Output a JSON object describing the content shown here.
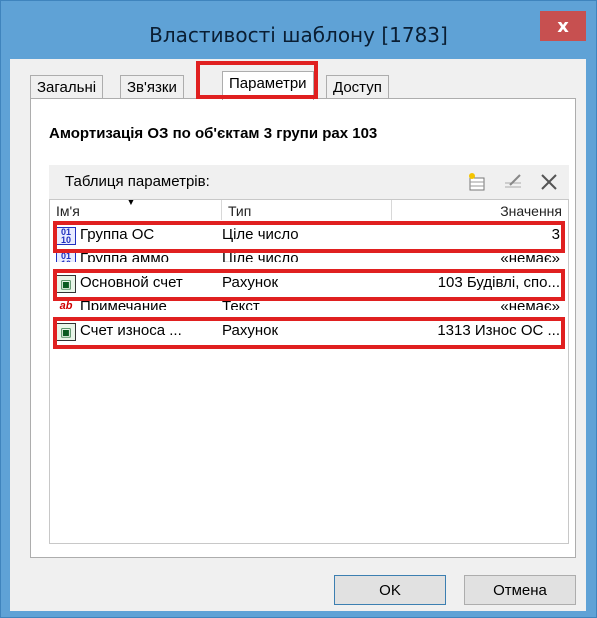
{
  "window": {
    "title": "Властивості шаблону [1783]",
    "close_label": "x"
  },
  "tabs": [
    {
      "label": "Загальні"
    },
    {
      "label": "Зв'язки"
    },
    {
      "label": "Параметри"
    },
    {
      "label": "Доступ"
    }
  ],
  "template_name": "Амортизація ОЗ по об'єктам 3 групи рах 103",
  "params_table": {
    "title": "Таблиця параметрів:",
    "columns": [
      "Ім'я",
      "Тип",
      "Значення"
    ],
    "rows": [
      {
        "name": "Группа ОС",
        "type": "Ціле число",
        "value": "3",
        "icon": "integer-icon"
      },
      {
        "name": "Группа аммо",
        "type": "Ціле число",
        "value": "«немає»",
        "icon": "integer-icon"
      },
      {
        "name": "Основной счет",
        "type": "Рахунок",
        "value": "103 Будівлі, спо...",
        "icon": "account-icon"
      },
      {
        "name": "Примечание",
        "type": "Текст",
        "value": "«немає»",
        "icon": "text-icon"
      },
      {
        "name": "Счет износа ...",
        "type": "Рахунок",
        "value": "1313 Износ ОС ...",
        "icon": "account-icon"
      }
    ]
  },
  "buttons": {
    "ok": "OK",
    "cancel": "Отмена"
  },
  "colors": {
    "title_bar": "#5fa2d6",
    "close_button": "#c75050",
    "highlight": "#e02020"
  }
}
